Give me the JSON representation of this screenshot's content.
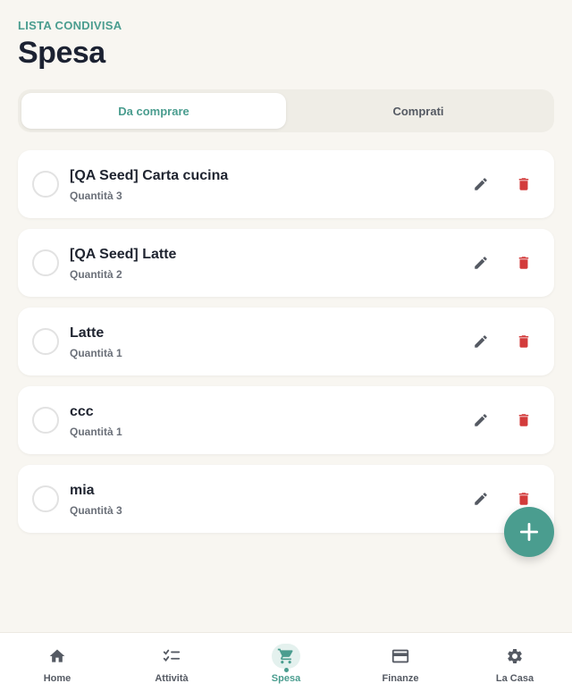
{
  "header": {
    "overline": "LISTA CONDIVISA",
    "title": "Spesa"
  },
  "tabs": [
    {
      "label": "Da comprare",
      "active": true
    },
    {
      "label": "Comprati",
      "active": false
    }
  ],
  "items": [
    {
      "name": "[QA Seed] Carta cucina",
      "quantity": "Quantità 3"
    },
    {
      "name": "[QA Seed] Latte",
      "quantity": "Quantità 2"
    },
    {
      "name": "Latte",
      "quantity": "Quantità 1"
    },
    {
      "name": "ccc",
      "quantity": "Quantità 1"
    },
    {
      "name": "mia",
      "quantity": "Quantità 3"
    }
  ],
  "fab": {
    "icon": "plus-icon"
  },
  "bottom_nav": [
    {
      "label": "Home",
      "icon": "home-icon",
      "active": false
    },
    {
      "label": "Attività",
      "icon": "checklist-icon",
      "active": false
    },
    {
      "label": "Spesa",
      "icon": "cart-icon",
      "active": true
    },
    {
      "label": "Finanze",
      "icon": "credit-card-icon",
      "active": false
    },
    {
      "label": "La Casa",
      "icon": "gear-icon",
      "active": false
    }
  ],
  "colors": {
    "accent": "#4a9d8f",
    "background": "#f8f6f1",
    "delete": "#d33b3b",
    "edit": "#555a63"
  }
}
